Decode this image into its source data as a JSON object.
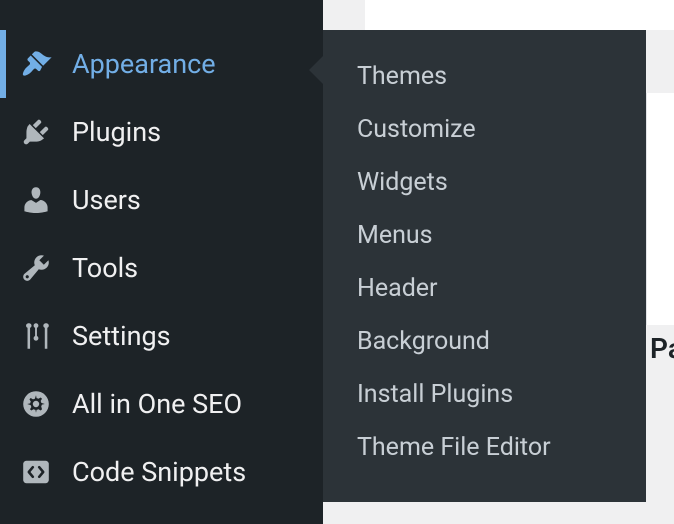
{
  "sidebar": {
    "items": [
      {
        "label": "Appearance"
      },
      {
        "label": "Plugins"
      },
      {
        "label": "Users"
      },
      {
        "label": "Tools"
      },
      {
        "label": "Settings"
      },
      {
        "label": "All in One SEO"
      },
      {
        "label": "Code Snippets"
      }
    ]
  },
  "flyout": {
    "items": [
      {
        "label": "Themes"
      },
      {
        "label": "Customize"
      },
      {
        "label": "Widgets"
      },
      {
        "label": "Menus"
      },
      {
        "label": "Header"
      },
      {
        "label": "Background"
      },
      {
        "label": "Install Plugins"
      },
      {
        "label": "Theme File Editor"
      }
    ]
  },
  "content": {
    "partial_heading": "Pa"
  }
}
